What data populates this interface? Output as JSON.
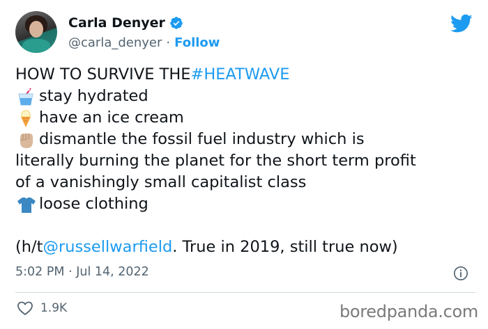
{
  "author": {
    "display_name": "Carla Denyer",
    "handle": "@carla_denyer",
    "separator": "·",
    "follow_label": "Follow",
    "verified": true
  },
  "tweet": {
    "line1_prefix": "HOW TO SURVIVE THE ",
    "line1_hashtag": "#HEATWAVE",
    "item1": "stay hydrated",
    "item1_icon": "cup-with-straw-icon",
    "item2": "have an ice cream",
    "item2_icon": "ice-cream-icon",
    "item3_a": "dismantle the fossil fuel industry which is",
    "item3_b": "literally burning the planet for the short term profit",
    "item3_c": "of a vanishingly small capitalist class",
    "item3_icon": "raised-fist-icon",
    "item4": "loose clothing",
    "item4_icon": "t-shirt-icon",
    "footer_prefix": "(h/t ",
    "footer_mention": "@russellwarfield",
    "footer_suffix": ". True in 2019, still true now)"
  },
  "meta": {
    "timestamp": "5:02 PM · Jul 14, 2022",
    "likes": "1.9K"
  },
  "watermark": "boredpanda.com",
  "colors": {
    "accent": "#1d9bf0",
    "text": "#0f1419",
    "muted": "#536471"
  }
}
